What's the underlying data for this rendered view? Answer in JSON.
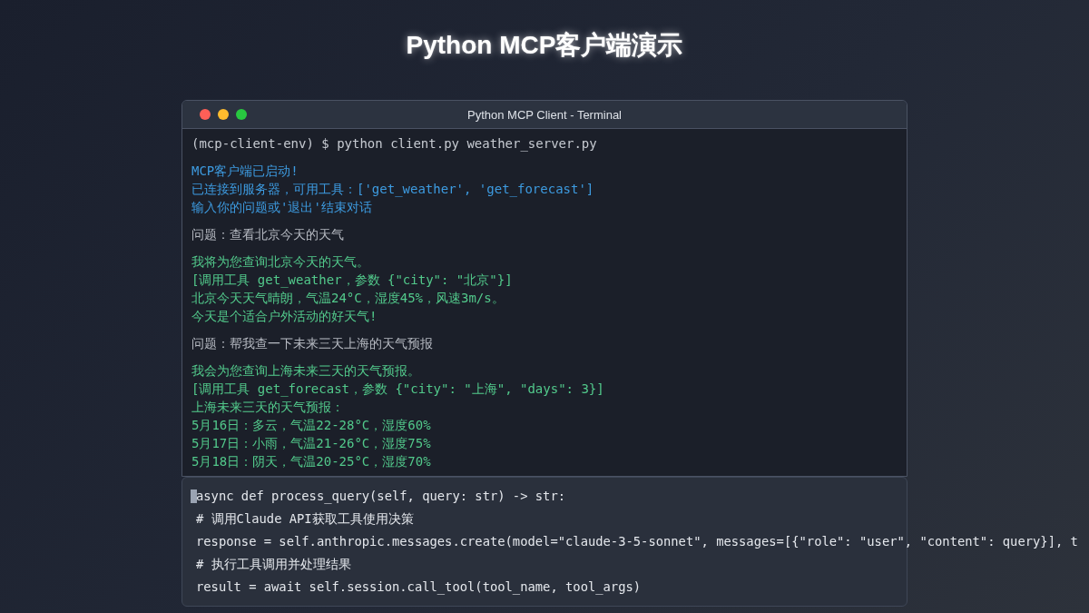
{
  "page": {
    "title": "Python MCP客户端演示"
  },
  "terminal": {
    "title": "Python MCP Client - Terminal",
    "blocks": [
      {
        "kind": "command",
        "lines": [
          "(mcp-client-env) $ python client.py weather_server.py"
        ]
      },
      {
        "kind": "system",
        "lines": [
          "MCP客户端已启动!",
          "已连接到服务器，可用工具：['get_weather', 'get_forecast']",
          "输入你的问题或'退出'结束对话"
        ]
      },
      {
        "kind": "question",
        "lines": [
          "问题：查看北京今天的天气"
        ]
      },
      {
        "kind": "answer",
        "lines": [
          "我将为您查询北京今天的天气。",
          "[调用工具 get_weather，参数 {\"city\": \"北京\"}]",
          "北京今天天气晴朗，气温24°C，湿度45%，风速3m/s。",
          "今天是个适合户外活动的好天气!"
        ]
      },
      {
        "kind": "question",
        "lines": [
          "问题：帮我查一下未来三天上海的天气预报"
        ]
      },
      {
        "kind": "answer",
        "lines": [
          "我会为您查询上海未来三天的天气预报。",
          "[调用工具 get_forecast，参数 {\"city\": \"上海\", \"days\": 3}]",
          "上海未来三天的天气预报：",
          "5月16日：多云，气温22-28°C，湿度60%",
          "5月17日：小雨，气温21-26°C，湿度75%",
          "5月18日：阴天，气温20-25°C，湿度70%"
        ]
      }
    ]
  },
  "code": {
    "lines": [
      {
        "text": "async def process_query(self, query: str) -> str:",
        "cursor": true
      },
      {
        "text": "# 调用Claude API获取工具使用决策",
        "cursor": false
      },
      {
        "text": "response = self.anthropic.messages.create(model=\"claude-3-5-sonnet\", messages=[{\"role\": \"user\", \"content\": query}], t",
        "cursor": false
      },
      {
        "text": "# 执行工具调用并处理结果",
        "cursor": false
      },
      {
        "text": "result = await self.session.call_tool(tool_name, tool_args)",
        "cursor": false
      }
    ]
  }
}
